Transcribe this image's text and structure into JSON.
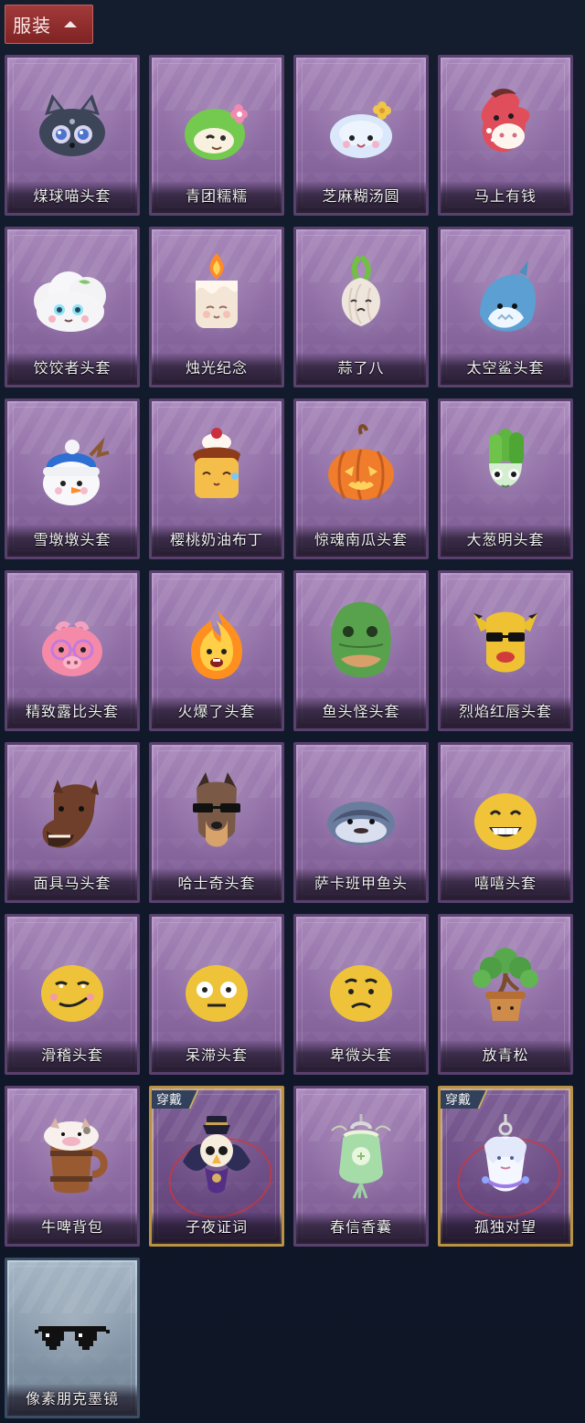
{
  "header": {
    "title": "服装"
  },
  "tags": {
    "wearing": "穿戴"
  },
  "items": [
    {
      "label": "煤球喵头套",
      "icon": "black-cat-mask-icon",
      "variant": "purple"
    },
    {
      "label": "青团糯糯",
      "icon": "green-rice-dumpling-icon",
      "variant": "purple"
    },
    {
      "label": "芝麻糊汤圆",
      "icon": "rice-ball-icon",
      "variant": "purple"
    },
    {
      "label": "马上有钱",
      "icon": "red-horse-mask-icon",
      "variant": "purple"
    },
    {
      "label": "饺饺者头套",
      "icon": "dumpling-mask-icon",
      "variant": "purple"
    },
    {
      "label": "烛光纪念",
      "icon": "candle-mask-icon",
      "variant": "purple"
    },
    {
      "label": "蒜了八",
      "icon": "garlic-mask-icon",
      "variant": "purple"
    },
    {
      "label": "太空鲨头套",
      "icon": "space-shark-mask-icon",
      "variant": "purple"
    },
    {
      "label": "雪墩墩头套",
      "icon": "snowman-mask-icon",
      "variant": "purple"
    },
    {
      "label": "樱桃奶油布丁",
      "icon": "pudding-mask-icon",
      "variant": "purple"
    },
    {
      "label": "惊魂南瓜头套",
      "icon": "pumpkin-mask-icon",
      "variant": "purple"
    },
    {
      "label": "大葱明头套",
      "icon": "green-onion-mask-icon",
      "variant": "purple"
    },
    {
      "label": "精致露比头套",
      "icon": "pink-pig-glasses-icon",
      "variant": "purple"
    },
    {
      "label": "火爆了头套",
      "icon": "fire-mask-icon",
      "variant": "purple"
    },
    {
      "label": "鱼头怪头套",
      "icon": "fish-head-mask-icon",
      "variant": "purple"
    },
    {
      "label": "烈焰红唇头套",
      "icon": "yellow-mouse-mask-icon",
      "variant": "purple"
    },
    {
      "label": "面具马头套",
      "icon": "horse-mask-icon",
      "variant": "purple"
    },
    {
      "label": "哈士奇头套",
      "icon": "husky-mask-icon",
      "variant": "purple"
    },
    {
      "label": "萨卡班甲鱼头",
      "icon": "fish-mask-icon",
      "variant": "purple"
    },
    {
      "label": "嘻嘻头套",
      "icon": "grinning-emoji-mask-icon",
      "variant": "purple"
    },
    {
      "label": "滑稽头套",
      "icon": "funny-emoji-mask-icon",
      "variant": "purple"
    },
    {
      "label": "呆滞头套",
      "icon": "blank-stare-emoji-mask-icon",
      "variant": "purple"
    },
    {
      "label": "卑微头套",
      "icon": "sad-emoji-mask-icon",
      "variant": "purple"
    },
    {
      "label": "放青松",
      "icon": "bonsai-tree-icon",
      "variant": "purple"
    },
    {
      "label": "牛啤背包",
      "icon": "cow-beer-backpack-icon",
      "variant": "purple"
    },
    {
      "label": "子夜证词",
      "icon": "night-owl-pendant-icon",
      "variant": "gold",
      "tag": "穿戴"
    },
    {
      "label": "春信香囊",
      "icon": "spring-sachet-icon",
      "variant": "purple"
    },
    {
      "label": "孤独对望",
      "icon": "white-doll-pendant-icon",
      "variant": "gold",
      "tag": "穿戴"
    },
    {
      "label": "像素朋克墨镜",
      "icon": "pixel-sunglasses-icon",
      "variant": "blue"
    }
  ]
}
